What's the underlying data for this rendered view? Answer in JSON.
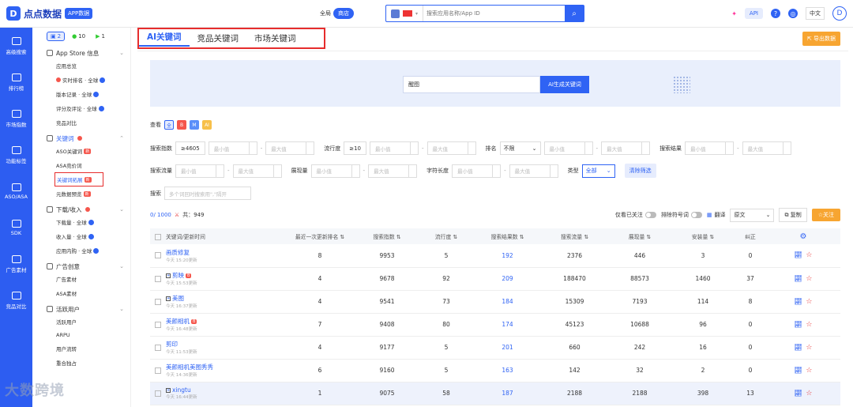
{
  "header": {
    "logo_text": "点点数据",
    "badge": "APP数据",
    "region_global": "全局",
    "region_store": "商店",
    "search_placeholder": "搜索应用名称/App ID",
    "api": "API",
    "lang": "中文",
    "avatar": "D"
  },
  "rail": [
    {
      "label": "高级搜索"
    },
    {
      "label": "排行榜"
    },
    {
      "label": "市场指数"
    },
    {
      "label": "功能标签"
    },
    {
      "label": "ASO/ASA"
    },
    {
      "label": "SDK"
    },
    {
      "label": "广告素材"
    },
    {
      "label": "竞品对比"
    }
  ],
  "sidebar": {
    "os": [
      {
        "label": "2"
      },
      {
        "label": "10"
      },
      {
        "label": "1"
      }
    ],
    "sections": [
      {
        "title": "App Store 信息",
        "items": [
          "应用总览",
          "实时排名 · 全球",
          "版本记录 · 全球",
          "评分及评论 · 全球",
          "竞品对比"
        ]
      },
      {
        "title": "关键词",
        "items": [
          "ASO关键词",
          "ASA竞价词",
          "关键词拓展",
          "元数据预览"
        ]
      },
      {
        "title": "下载/收入",
        "items": [
          "下载量 · 全球",
          "收入量 · 全球",
          "应用内购 · 全球"
        ]
      },
      {
        "title": "广告创意",
        "items": [
          "广告素材",
          "ASA素材"
        ]
      },
      {
        "title": "活跃用户",
        "items": [
          "活跃用户",
          "ARPU",
          "用户流转",
          "重合独占"
        ]
      }
    ],
    "new_badge": "新"
  },
  "tabs": [
    "AI关键词",
    "竞品关键词",
    "市场关键词"
  ],
  "export": "导出数据",
  "banner": {
    "input_value": "醒图",
    "button": "AI生成关键词"
  },
  "filters": {
    "view_label": "查看",
    "view_all": "全",
    "index_label": "搜索指数",
    "index_value": "≥4605",
    "flow_label": "流行度",
    "flow_value": "≥10",
    "rank_label": "排名",
    "rank_value": "不限",
    "result_label": "搜索结果",
    "traffic_label": "搜索流量",
    "exposure_label": "展现量",
    "length_label": "字符长度",
    "type_label": "类型",
    "type_value": "全部",
    "clear": "清除筛选",
    "search_label": "搜索",
    "search_placeholder": "多个词回时搜索用\",\"隔开",
    "min": "最小值",
    "max": "最大值"
  },
  "info": {
    "count": "0/ 1000",
    "total": "共：949",
    "only_followed": "仅看已关注",
    "exclude_symbols": "排除符号词",
    "translate": "翻译",
    "original": "原文",
    "copy": "复制",
    "follow": "☆关注"
  },
  "table": {
    "headers": [
      "关键词/更新时间",
      "最近一次更新排名",
      "搜索指数",
      "流行度",
      "搜索结果数",
      "搜索流量",
      "展现量",
      "安装量",
      "纠正"
    ],
    "rows": [
      {
        "kw": "画质修复",
        "time": "今天 15:20更新",
        "rank": "8",
        "index": "9953",
        "pop": "5",
        "results": "192",
        "traffic": "2376",
        "expo": "446",
        "install": "3",
        "fix": "0",
        "tag": ""
      },
      {
        "kw": "剪映",
        "time": "今天 15:53更新",
        "rank": "4",
        "index": "9678",
        "pop": "92",
        "results": "209",
        "traffic": "188470",
        "expo": "88573",
        "install": "1460",
        "fix": "37",
        "tag": "B"
      },
      {
        "kw": "美图",
        "time": "今天 16:37更新",
        "rank": "4",
        "index": "9541",
        "pop": "73",
        "results": "184",
        "traffic": "15309",
        "expo": "7193",
        "install": "114",
        "fix": "8",
        "tag": ""
      },
      {
        "kw": "美颜相机",
        "time": "今天 16:48更新",
        "rank": "7",
        "index": "9408",
        "pop": "80",
        "results": "174",
        "traffic": "45123",
        "expo": "10688",
        "install": "96",
        "fix": "0",
        "tag": "B"
      },
      {
        "kw": "剪印",
        "time": "今天 11:53更新",
        "rank": "4",
        "index": "9177",
        "pop": "5",
        "results": "201",
        "traffic": "660",
        "expo": "242",
        "install": "16",
        "fix": "0",
        "tag": ""
      },
      {
        "kw": "美颜相机美图秀秀",
        "time": "今天 14:36更新",
        "rank": "6",
        "index": "9160",
        "pop": "5",
        "results": "163",
        "traffic": "142",
        "expo": "32",
        "install": "2",
        "fix": "0",
        "tag": ""
      },
      {
        "kw": "xingtu",
        "time": "今天 16:44更新",
        "rank": "1",
        "index": "9075",
        "pop": "58",
        "results": "187",
        "traffic": "2188",
        "expo": "2188",
        "install": "398",
        "fix": "13",
        "tag": ""
      }
    ]
  },
  "watermark": "大数跨境",
  "colors": {
    "primary": "#2f63f4",
    "accent": "#f7a531",
    "highlight": "#e62d2d"
  }
}
